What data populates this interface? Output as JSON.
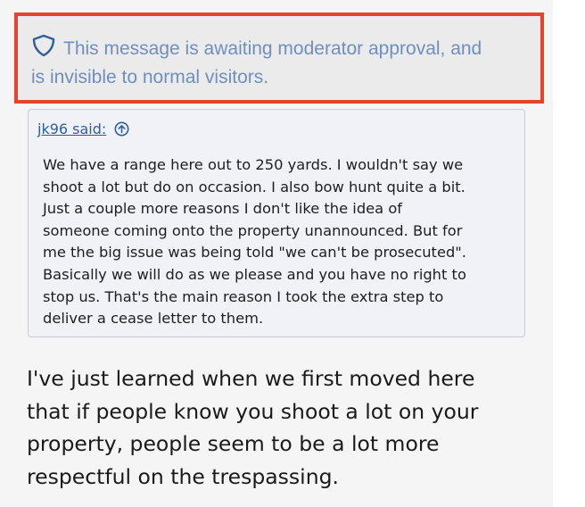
{
  "moderation": {
    "icon": "shield-icon",
    "line1": "This message is awaiting moderator approval, and",
    "line2": "is invisible to normal visitors.",
    "accent_border": "#e8442a",
    "text_color": "#6e8fc0"
  },
  "quote": {
    "author": "jk96 said:",
    "jump_icon": "arrow-up-circle-icon",
    "lines": [
      "We have a range here out to 250 yards. I wouldn't say we",
      "shoot a lot but do on occasion. I also bow hunt quite a bit.",
      "Just a couple more reasons I don't like the idea of",
      "someone coming onto the property unannounced. But for",
      "me the big issue was being told \"we can't be prosecuted\".",
      "Basically we will do as we please and you have no right to",
      "stop us. That's the main reason I took the extra step to",
      "deliver a cease letter to them."
    ]
  },
  "post": {
    "lines": [
      "I've just learned when we first moved here",
      "that if people know you shoot a lot on your",
      "property, people seem to be a lot more",
      "respectful on the trespassing."
    ]
  }
}
